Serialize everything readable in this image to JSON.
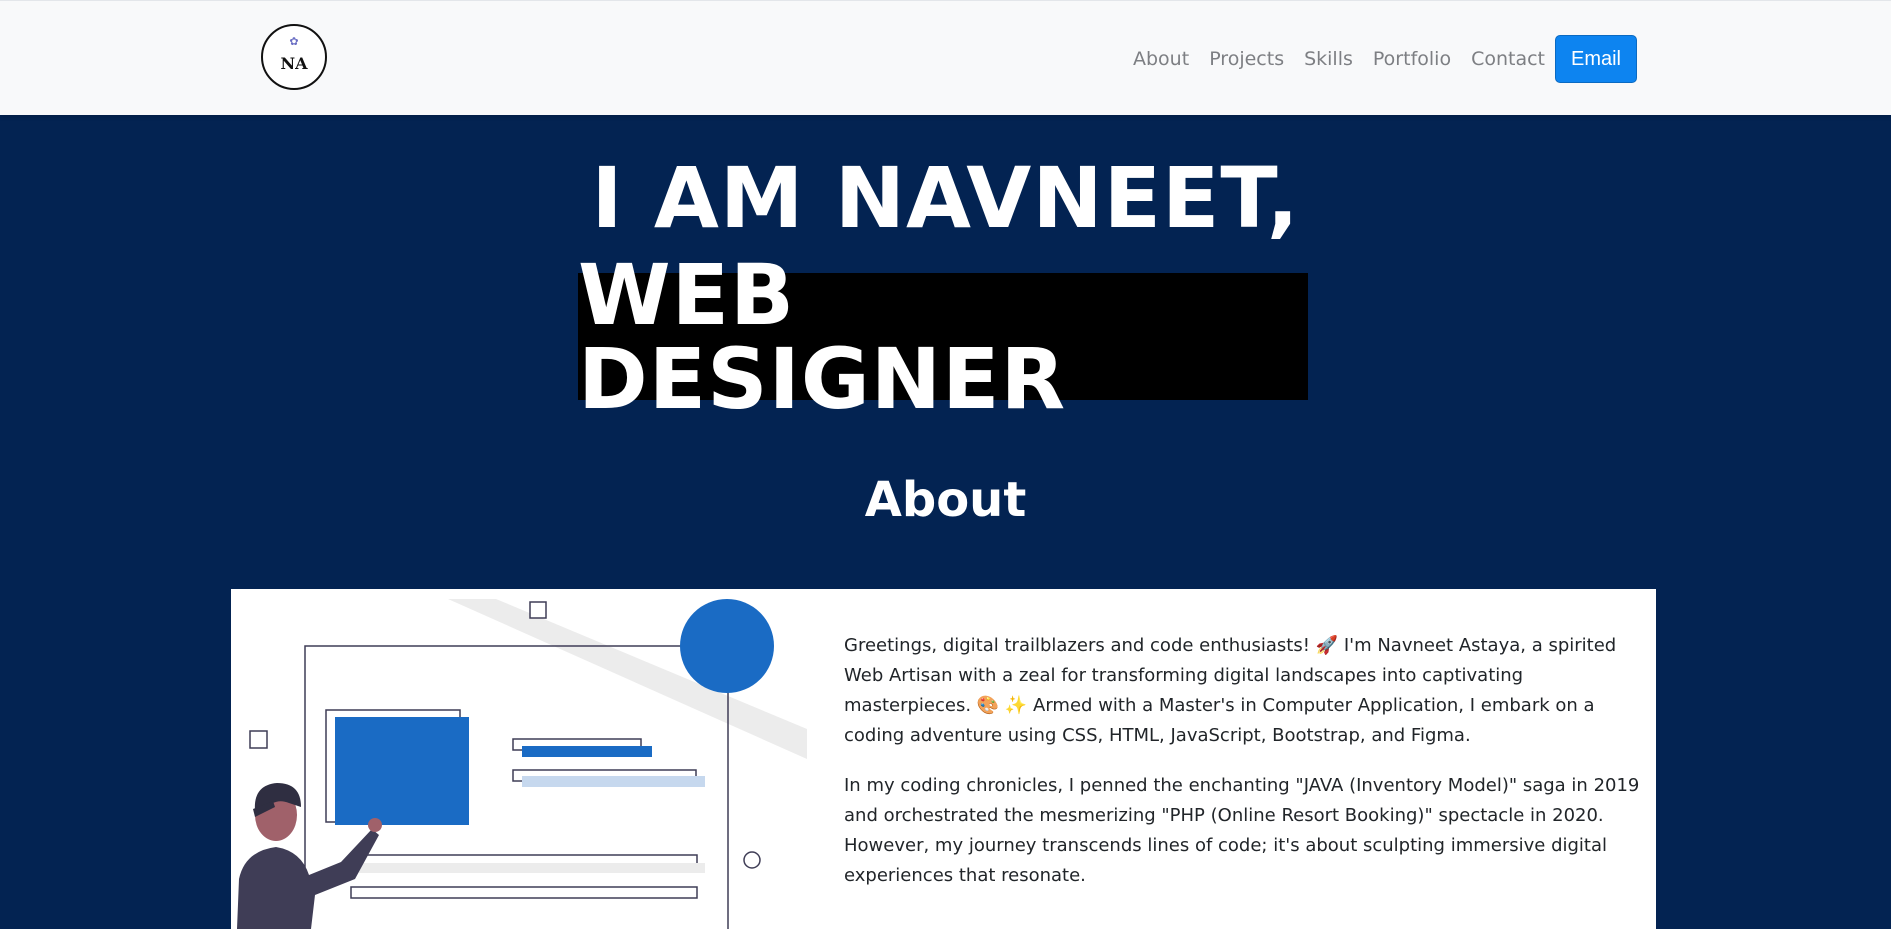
{
  "navbar": {
    "logo_text": "NA",
    "links": [
      "About",
      "Projects",
      "Skills",
      "Portfolio",
      "Contact"
    ],
    "email_button": "Email",
    "brand_color": "#0d84f0"
  },
  "hero": {
    "line1": "I AM NAVNEET,",
    "line2": "WEB DESIGNER",
    "background": "#032352"
  },
  "about": {
    "title": "About",
    "paragraph1": "Greetings, digital trailblazers and code enthusiasts! 🚀 I'm Navneet Astaya, a spirited Web Artisan with a zeal for transforming digital landscapes into captivating masterpieces. 🎨 ✨ Armed with a Master's in Computer Application, I embark on a coding adventure using CSS, HTML, JavaScript, Bootstrap, and Figma.",
    "paragraph2": "In my coding chronicles, I penned the enchanting \"JAVA (Inventory Model)\" saga in 2019 and orchestrated the mesmerizing \"PHP (Online Resort Booking)\" spectacle in 2020. However, my journey transcends lines of code; it's about sculpting immersive digital experiences that resonate.",
    "illustration_accent": "#1a6bc4"
  }
}
